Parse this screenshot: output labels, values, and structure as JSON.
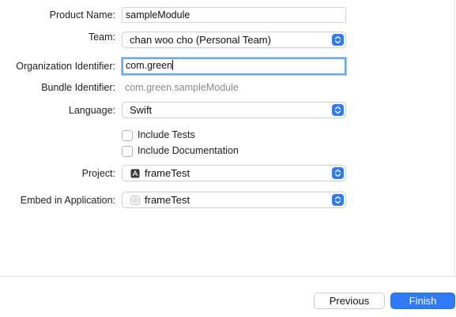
{
  "form": {
    "product_name": {
      "label": "Product Name:",
      "value": "sampleModule"
    },
    "team": {
      "label": "Team:",
      "value": "chan woo cho (Personal Team)"
    },
    "organization_identifier": {
      "label": "Organization Identifier:",
      "value": "com.green"
    },
    "bundle_identifier": {
      "label": "Bundle Identifier:",
      "value": "com.green.sampleModule"
    },
    "language": {
      "label": "Language:",
      "value": "Swift"
    },
    "include_tests": {
      "label": "Include Tests",
      "checked": false
    },
    "include_documentation": {
      "label": "Include Documentation",
      "checked": false
    },
    "project": {
      "label": "Project:",
      "value": "frameTest",
      "icon": "xcode-project-icon"
    },
    "embed_in_application": {
      "label": "Embed in Application:",
      "value": "frameTest",
      "icon": "app-target-icon"
    }
  },
  "footer": {
    "previous_label": "Previous",
    "finish_label": "Finish"
  },
  "colors": {
    "accent": "#2f7bf6",
    "focus_ring": "#6aa5ee",
    "secondary_text": "#8a8a8a"
  }
}
